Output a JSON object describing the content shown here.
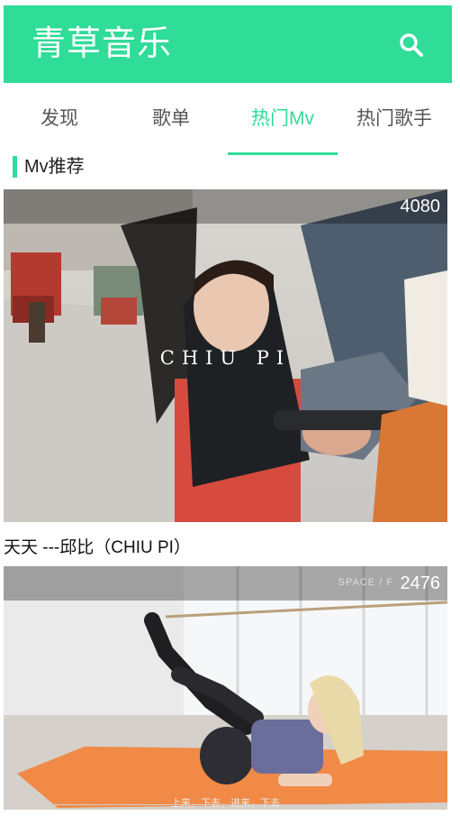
{
  "header": {
    "title": "青草音乐",
    "icon": "search-icon",
    "accent": "#2fdc98"
  },
  "tabs": [
    {
      "label": "发现",
      "active": false
    },
    {
      "label": "歌单",
      "active": false
    },
    {
      "label": "热门Mv",
      "active": true
    },
    {
      "label": "热门歌手",
      "active": false
    }
  ],
  "section": {
    "title": "Mv推荐"
  },
  "mvs": [
    {
      "count": "4080",
      "title": "天天 ---邱比（CHIU PI）",
      "cover_text": "CHIU PI"
    },
    {
      "count": "2476",
      "title": "",
      "cover_text": "上来，下去，进来，下去",
      "watermark": "SPACE / F"
    }
  ]
}
